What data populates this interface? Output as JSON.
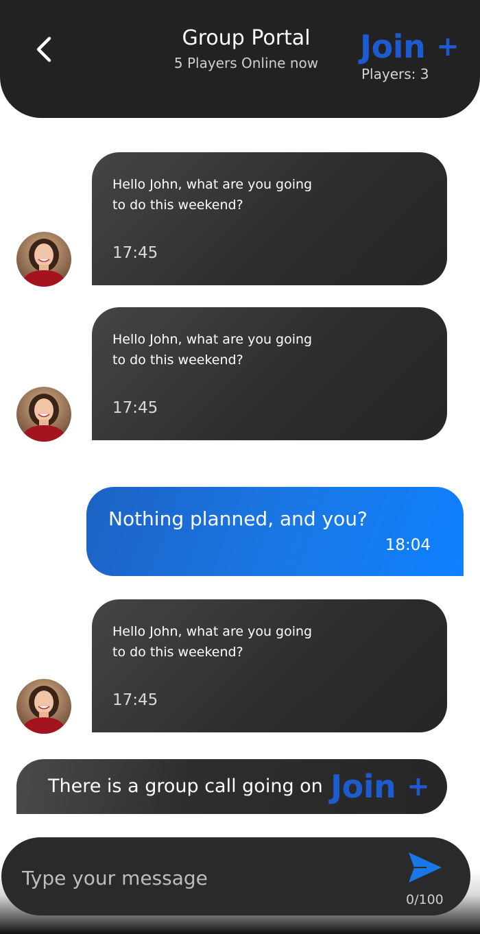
{
  "header": {
    "title": "Group Portal",
    "subtitle": "5 Players Online now",
    "join_label": "Join",
    "join_plus": "+",
    "players_label": "Players: 3"
  },
  "messages": [
    {
      "direction": "incoming",
      "text": "Hello John, what are you going to do this weekend?",
      "time": "17:45"
    },
    {
      "direction": "incoming",
      "text": "Hello John, what are you going to do this weekend?",
      "time": "17:45"
    },
    {
      "direction": "outgoing",
      "text": "Nothing planned, and you?",
      "time": "18:04"
    },
    {
      "direction": "incoming",
      "text": "Hello John, what are you going to do this weekend?",
      "time": "17:45"
    }
  ],
  "group_call": {
    "text": "There is a group call going on",
    "join_label": "Join",
    "join_plus": "+"
  },
  "composer": {
    "placeholder": "Type your message",
    "value": "",
    "char_count": "0/100"
  },
  "colors": {
    "accent": "#1f5bd0",
    "header_bg": "#222222",
    "outgoing_bubble": "#1a78e6",
    "incoming_bubble": "#2c2c2c"
  },
  "icons": {
    "back": "chevron-left-icon",
    "send": "send-icon",
    "avatar": "avatar-woman"
  }
}
